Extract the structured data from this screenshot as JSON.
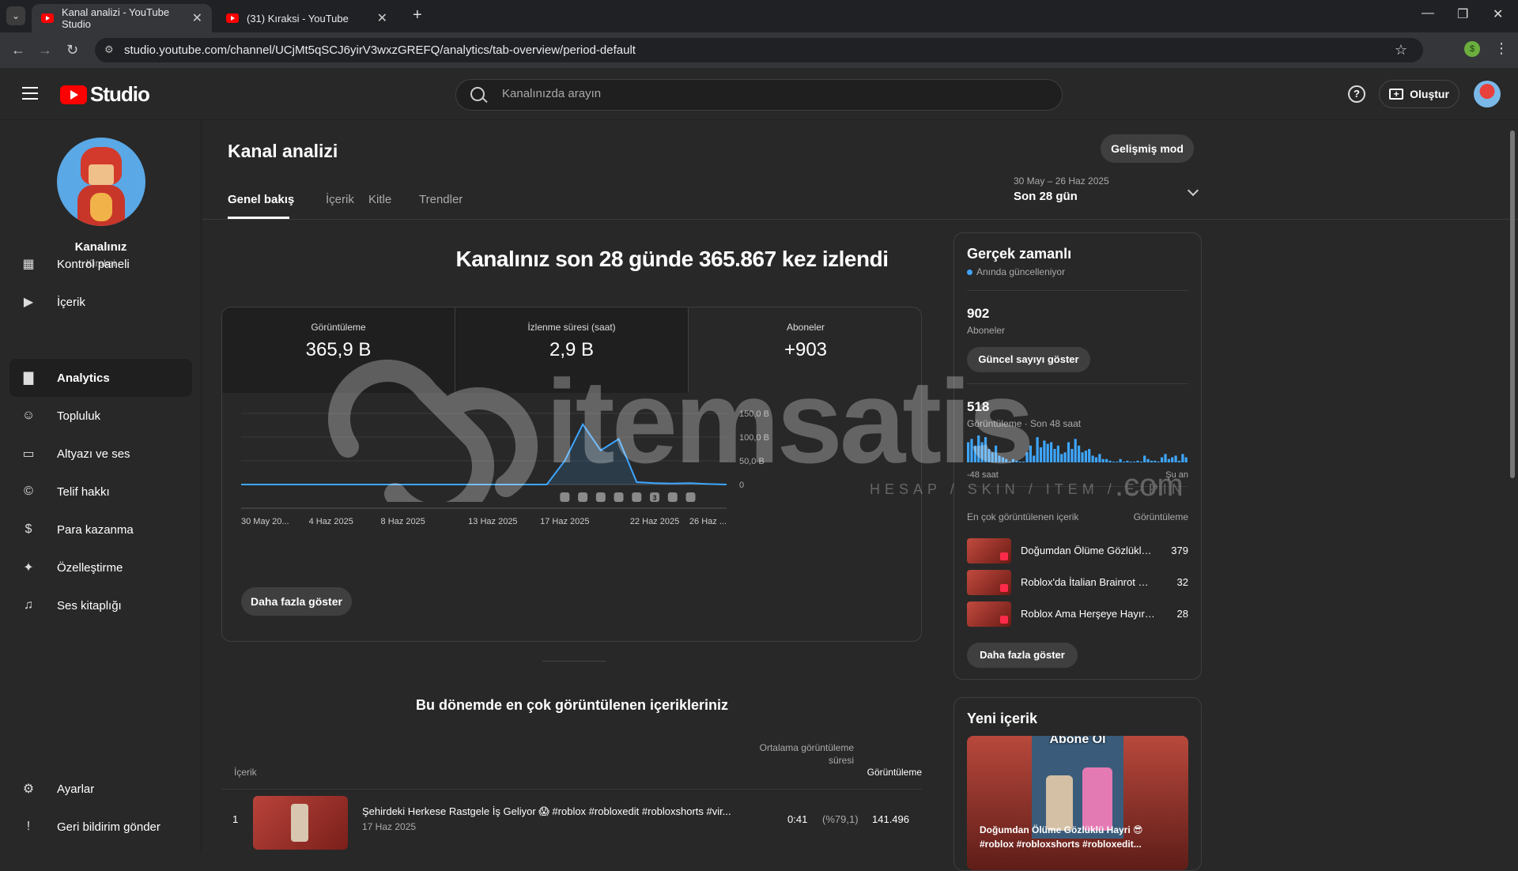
{
  "browser": {
    "tabs": [
      {
        "title": "Kanal analizi - YouTube Studio",
        "active": true
      },
      {
        "title": "(31) Kıraksi - YouTube",
        "active": false
      }
    ],
    "url": "studio.youtube.com/channel/UCjMt5qSCJ6yirV3wxzGREFQ/analytics/tab-overview/period-default",
    "extension_badge": "$"
  },
  "header": {
    "logo_text": "Studio",
    "search_placeholder": "Kanalınızda arayın",
    "create_label": "Oluştur",
    "help_glyph": "?"
  },
  "sidebar": {
    "channel_name": "Kanalınız",
    "channel_handle": "Kıraksi",
    "items": [
      {
        "label": "Kontrol paneli",
        "icon": "dashboard-icon"
      },
      {
        "label": "İçerik",
        "icon": "content-icon"
      },
      {
        "label": "Analytics",
        "icon": "analytics-icon",
        "active": true
      },
      {
        "label": "Topluluk",
        "icon": "community-icon"
      },
      {
        "label": "Altyazı ve ses",
        "icon": "subtitles-icon"
      },
      {
        "label": "Telif hakkı",
        "icon": "copyright-icon"
      },
      {
        "label": "Para kazanma",
        "icon": "dollar-icon"
      },
      {
        "label": "Özelleştirme",
        "icon": "wand-icon"
      },
      {
        "label": "Ses kitaplığı",
        "icon": "audio-library-icon"
      }
    ],
    "bottom": [
      {
        "label": "Ayarlar",
        "icon": "gear-icon"
      },
      {
        "label": "Geri bildirim gönder",
        "icon": "feedback-icon"
      }
    ]
  },
  "main": {
    "title": "Kanal analizi",
    "advanced_mode": "Gelişmiş mod",
    "tabs": [
      "Genel bakış",
      "İçerik",
      "Kitle",
      "Trendler"
    ],
    "period": {
      "range": "30 May – 26 Haz 2025",
      "label": "Son 28 gün"
    },
    "headline": "Kanalınız son 28 günde 365.867 kez izlendi",
    "metrics": [
      {
        "title": "Görüntüleme",
        "value": "365,9 B"
      },
      {
        "title": "İzlenme süresi (saat)",
        "value": "2,9 B"
      },
      {
        "title": "Aboneler",
        "value": "+903"
      }
    ],
    "more_button": "Daha fazla göster",
    "top_content_title": "Bu dönemde en çok görüntülenen içerikleriniz",
    "table": {
      "headers": {
        "content": "İçerik",
        "avg_duration": "Ortalama görüntüleme süresi",
        "views": "Görüntüleme"
      },
      "rows": [
        {
          "rank": "1",
          "title": "Şehirdeki Herkese Rastgele İş Geliyor 😱 #roblox #robloxedit #robloxshorts #vir...",
          "date": "17 Haz 2025",
          "duration": "0:41",
          "percent": "(%79,1)",
          "views": "141.496"
        }
      ]
    }
  },
  "chart_data": {
    "type": "line",
    "x": [
      "30 May",
      "31 May",
      "1 Haz",
      "2 Haz",
      "3 Haz",
      "4 Haz",
      "5 Haz",
      "6 Haz",
      "7 Haz",
      "8 Haz",
      "9 Haz",
      "10 Haz",
      "11 Haz",
      "12 Haz",
      "13 Haz",
      "14 Haz",
      "15 Haz",
      "16 Haz",
      "17 Haz",
      "18 Haz",
      "19 Haz",
      "20 Haz",
      "21 Haz",
      "22 Haz",
      "23 Haz",
      "24 Haz",
      "25 Haz",
      "26 Haz"
    ],
    "series": [
      {
        "values": [
          0,
          0,
          0,
          0,
          0,
          0,
          0,
          0,
          0,
          0,
          0,
          0,
          0,
          0,
          0,
          0,
          0,
          0,
          50000,
          127000,
          72000,
          96000,
          5000,
          3000,
          2000,
          3000,
          1000,
          0
        ]
      }
    ],
    "x_tick_labels": [
      "30 May 20...",
      "4 Haz 2025",
      "8 Haz 2025",
      "13 Haz 2025",
      "17 Haz 2025",
      "22 Haz 2025",
      "26 Haz ..."
    ],
    "y_tick_labels": [
      "150,0 B",
      "100,0 B",
      "50,0 B",
      "0"
    ],
    "ylim": [
      0,
      150000
    ],
    "line_color": "#3ea6ff",
    "upload_markers": [
      "17 Haz",
      "18 Haz",
      "19 Haz",
      "20 Haz",
      "21 Haz",
      "22 Haz",
      "23 Haz",
      "24 Haz"
    ],
    "upload_marker_count_label": "3"
  },
  "realtime": {
    "title": "Gerçek zamanlı",
    "status": "Anında güncelleniyor",
    "subs_value": "902",
    "subs_label": "Aboneler",
    "show_count_button": "Güncel sayıyı göster",
    "views_value": "518",
    "views_label": "Görüntüleme · Son 48 saat",
    "axis_left": "-48 saat",
    "axis_right": "Şu an",
    "bars": [
      12,
      14,
      10,
      16,
      12,
      15,
      8,
      6,
      10,
      4,
      3,
      2,
      0,
      2,
      1,
      0,
      0,
      6,
      10,
      4,
      15,
      9,
      13,
      11,
      12,
      8,
      10,
      5,
      6,
      12,
      8,
      14,
      10,
      6,
      7,
      8,
      4,
      3,
      5,
      2,
      2,
      1,
      0,
      0,
      2,
      0,
      1,
      0,
      0,
      1,
      0,
      4,
      2,
      1,
      1,
      0,
      3,
      5,
      2,
      3,
      4,
      1,
      5,
      3
    ],
    "top_header": "En çok görüntülenen içerik",
    "top_views_header": "Görüntüleme",
    "top_items": [
      {
        "title": "Doğumdan Ölüme Gözlüklü...",
        "views": "379"
      },
      {
        "title": "Roblox'da İtalian Brainrot Ka...",
        "views": "32"
      },
      {
        "title": "Roblox Ama Herşeye Hayır ...",
        "views": "28"
      }
    ],
    "more_button": "Daha fazla göster"
  },
  "new_content": {
    "title": "Yeni içerik",
    "thumb_overlay": "Abone Ol",
    "video_title": "Doğumdan Ölüme Gözlüklü Hayri 😎 #roblox #robloxshorts #robloxedit..."
  },
  "watermark": {
    "brand": "itemsatis",
    "tagline": "HESAP / SKIN / ITEM / E-PIN",
    "suffix": ".com"
  }
}
